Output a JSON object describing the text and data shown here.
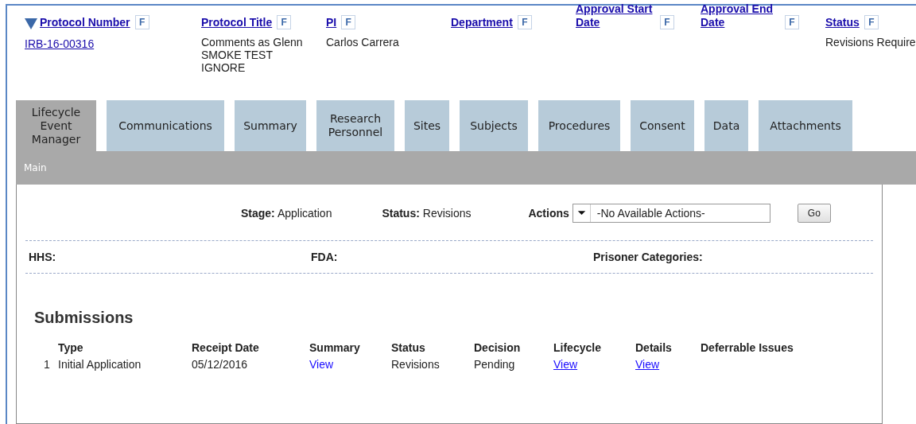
{
  "protocol_header": {
    "columns": [
      {
        "label": "Protocol Number",
        "sorted": true,
        "filter": "F",
        "link_value": "IRB-16-00316"
      },
      {
        "label": "Protocol Title",
        "sorted": false,
        "filter": "F",
        "value": "Comments as Glenn SMOKE TEST IGNORE"
      },
      {
        "label": "PI",
        "sorted": false,
        "filter": "F",
        "value": "Carlos Carrera"
      },
      {
        "label": "Department",
        "sorted": false,
        "filter": "F"
      },
      {
        "label": "Approval Start Date",
        "sorted": false,
        "filter": "F"
      },
      {
        "label": "Approval End Date",
        "sorted": false,
        "filter": "F"
      },
      {
        "label": "Status",
        "sorted": false,
        "filter": "F",
        "value": "Revisions Require"
      }
    ]
  },
  "tabs": [
    {
      "label": "Lifecycle Event Manager",
      "selected": true
    },
    {
      "label": "Communications",
      "selected": false
    },
    {
      "label": "Summary",
      "selected": false
    },
    {
      "label": "Research Personnel",
      "selected": false
    },
    {
      "label": "Sites",
      "selected": false
    },
    {
      "label": "Subjects",
      "selected": false
    },
    {
      "label": "Procedures",
      "selected": false
    },
    {
      "label": "Consent",
      "selected": false
    },
    {
      "label": "Data",
      "selected": false
    },
    {
      "label": "Attachments",
      "selected": false
    }
  ],
  "subtabs": [
    {
      "label": "Main",
      "selected": true
    }
  ],
  "stage_bar": {
    "stage_label": "Stage:",
    "stage": "Application",
    "status_label": "Status:",
    "status": "Revisions",
    "actions_label": "Actions",
    "actions_value": "-No Available Actions-",
    "go_button": "Go"
  },
  "categories": [
    {
      "label": "HHS:"
    },
    {
      "label": "FDA:"
    },
    {
      "label": "Prisoner Categories:"
    }
  ],
  "submissions": {
    "title": "Submissions",
    "columns": [
      "Type",
      "Receipt Date",
      "Summary",
      "Status",
      "Decision",
      "Lifecycle",
      "Details",
      "Deferrable Issues"
    ],
    "rows": [
      {
        "index": "1",
        "type": "Initial Application",
        "receipt_date": "05/12/2016",
        "summary": "View",
        "status": "Revisions",
        "decision": "Pending",
        "lifecycle": "View",
        "details": "View"
      }
    ]
  }
}
